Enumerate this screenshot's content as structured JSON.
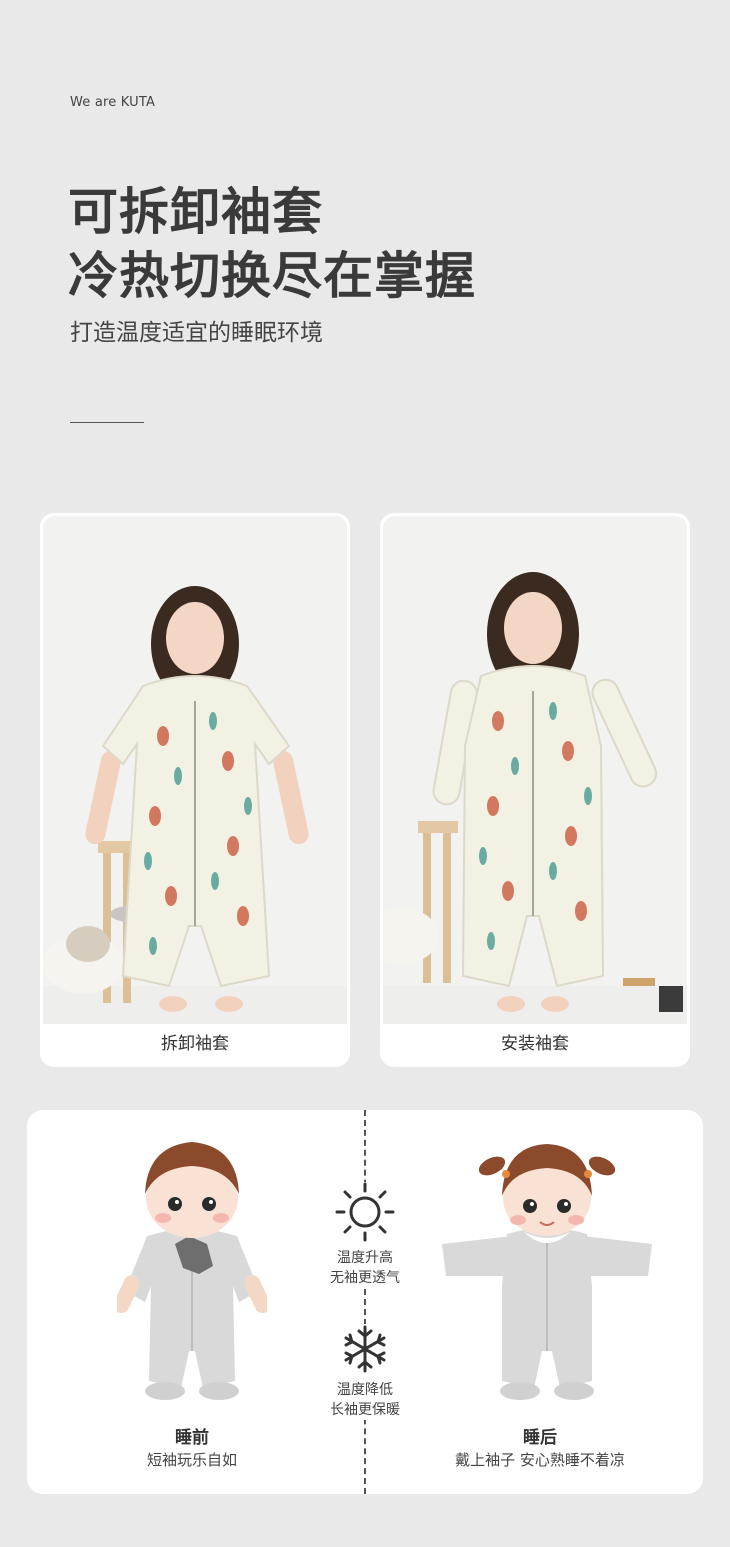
{
  "header": {
    "brand": "We are KUTA",
    "title_line1": "可拆卸袖套",
    "title_line2": "冷热切换尽在掌握",
    "subtitle": "打造温度适宜的睡眠环境"
  },
  "photos": [
    {
      "caption": "拆卸袖套"
    },
    {
      "caption": "安装袖套"
    }
  ],
  "comparison": {
    "hot": {
      "icon": "sun-icon",
      "line1": "温度升高",
      "line2": "无袖更透气"
    },
    "cold": {
      "icon": "snowflake-icon",
      "line1": "温度降低",
      "line2": "长袖更保暖"
    },
    "before": {
      "title": "睡前",
      "subtitle": "短袖玩乐自如"
    },
    "after": {
      "title": "睡后",
      "subtitle": "戴上袖子 安心熟睡不着凉"
    }
  },
  "colors": {
    "background": "#e9e9e9",
    "card": "#ffffff",
    "text_dark": "#3a3a3a",
    "garment_gray": "#d9d9d9"
  }
}
